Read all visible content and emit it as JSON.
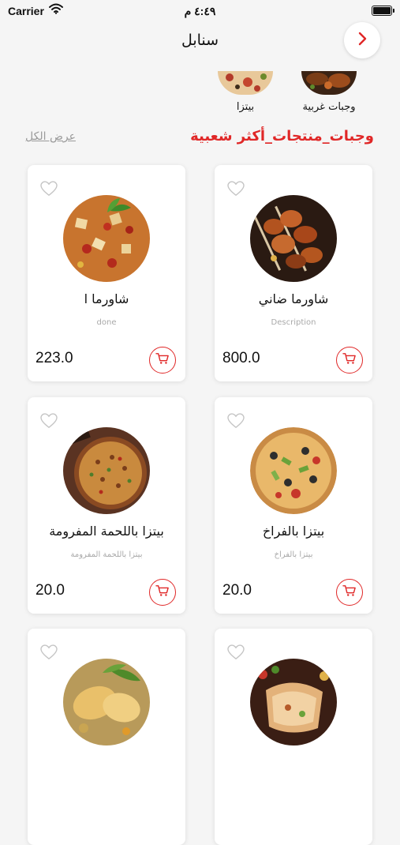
{
  "status": {
    "carrier": "Carrier",
    "time": "٤:٤٩ م"
  },
  "header": {
    "title": "سنابل"
  },
  "categories": [
    {
      "label": "وجبات غربية"
    },
    {
      "label": "بيتزا"
    }
  ],
  "section": {
    "title": "وجبات_منتجات_أكثر شعبية",
    "see_all": "عرض الكل"
  },
  "products": [
    {
      "name": "شاورما ضاني",
      "description": "Description",
      "price": "800.0"
    },
    {
      "name": "شاورما ا",
      "description": "done",
      "price": "223.0"
    },
    {
      "name": "بيتزا بالفراخ",
      "description": "بيتزا بالفراخ",
      "price": "20.0"
    },
    {
      "name": "بيتزا باللحمة المفرومة",
      "description": "بيتزا باللحمة المفرومة",
      "price": "20.0"
    },
    {
      "name": "",
      "description": "",
      "price": ""
    },
    {
      "name": "",
      "description": "",
      "price": ""
    }
  ],
  "colors": {
    "accent": "#e02727",
    "background": "#f5f5f5",
    "card": "#ffffff"
  },
  "icons": [
    "wifi-icon",
    "battery-icon",
    "chevron-right-icon",
    "heart-icon",
    "cart-icon"
  ]
}
